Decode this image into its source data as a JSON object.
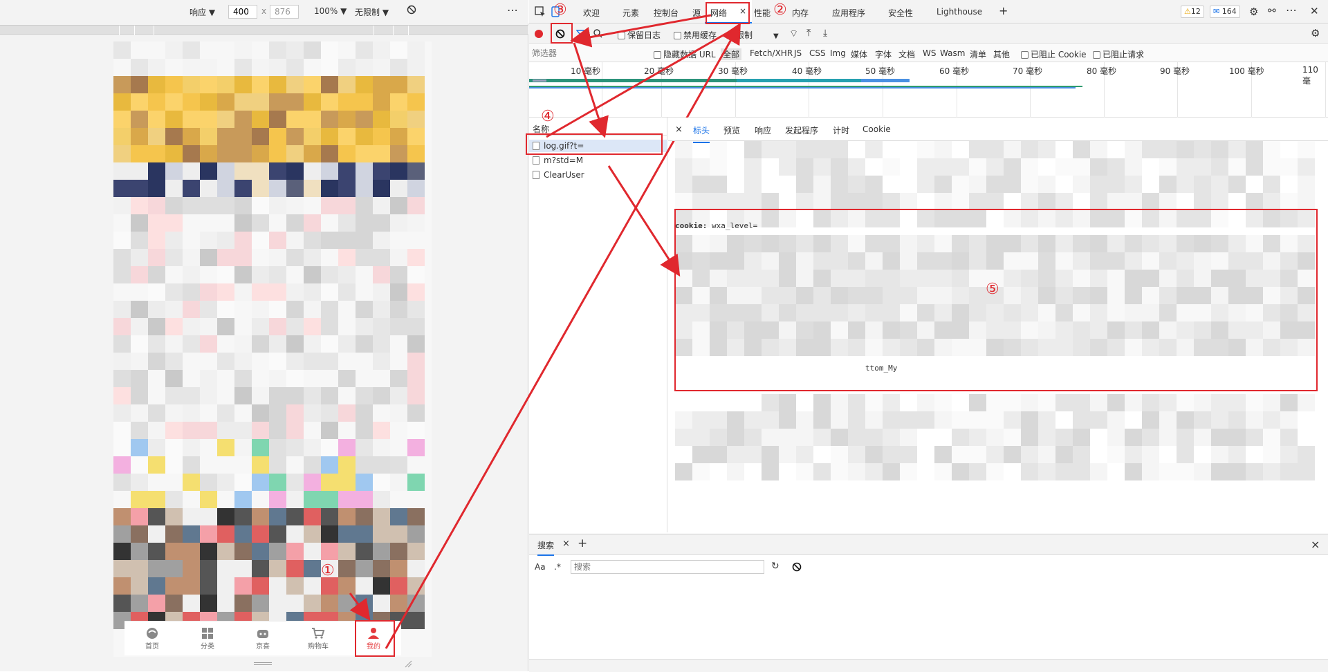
{
  "device_toolbar": {
    "device": "响应 ▼",
    "width": "400",
    "times": "x",
    "height": "876",
    "zoom": "100% ▼",
    "throttle": "无限制 ▼",
    "more": "⋮"
  },
  "phone_tabbar": {
    "items": [
      {
        "label": "首页"
      },
      {
        "label": "分类"
      },
      {
        "label": "京喜"
      },
      {
        "label": "购物车"
      },
      {
        "label": "我的"
      }
    ]
  },
  "devtools_tabs": {
    "items": [
      "欢迎",
      "元素",
      "控制台",
      "源",
      "网络",
      "性能",
      "内存",
      "应用程序",
      "安全性",
      "Lighthouse"
    ],
    "active": "网络",
    "close": "×",
    "add": "+",
    "warnings": "12",
    "messages": "164"
  },
  "network_toolbar": {
    "preserve_log": "保留日志",
    "disable_cache": "禁用缓存",
    "throttle": "无限制"
  },
  "filter_bar": {
    "placeholder": "筛选器",
    "hide_data_urls": "隐藏数据 URL",
    "types": [
      "全部",
      "Fetch/XHR",
      "JS",
      "CSS",
      "Img",
      "媒体",
      "字体",
      "文档",
      "WS",
      "Wasm",
      "清单",
      "其他"
    ],
    "blocked_cookies": "已阻止 Cookie",
    "blocked_requests": "已阻止请求"
  },
  "timeline": {
    "ticks": [
      "10 毫秒",
      "20 毫秒",
      "30 毫秒",
      "40 毫秒",
      "50 毫秒",
      "60 毫秒",
      "70 毫秒",
      "80 毫秒",
      "90 毫秒",
      "100 毫秒",
      "110 毫"
    ]
  },
  "requests": {
    "header": "名称",
    "rows": [
      "log.gif?t=",
      "m?std=M",
      "ClearUser"
    ]
  },
  "detail_tabs": {
    "close": "×",
    "items": [
      "标头",
      "预览",
      "响应",
      "发起程序",
      "计时",
      "Cookie"
    ],
    "active": "标头"
  },
  "detail": {
    "cookie_key": "cookie:",
    "cookie_value_start": "wxa_level=",
    "cookie_fragment": "ttom_My"
  },
  "search_drawer": {
    "tab": "搜索",
    "close": "×",
    "add": "+",
    "case": "Aa",
    "regex": ".*",
    "placeholder": "搜索",
    "drawer_close": "×"
  },
  "annotations": {
    "n1": "①",
    "n2": "②",
    "n3": "③",
    "n4": "④",
    "n5": "⑤"
  },
  "colors": {
    "accent_red": "#e0282e",
    "jd_red": "#e4393c",
    "blue_active": "#1a73e8"
  }
}
